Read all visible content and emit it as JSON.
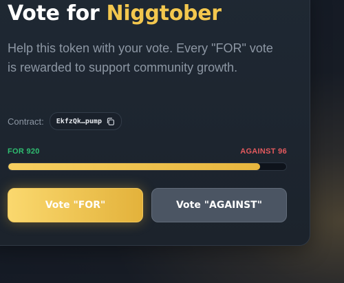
{
  "header": {
    "title_prefix": "Vote for ",
    "title_token": "Niggtober"
  },
  "description": "Help this token with your vote. Every \"FOR\" vote is rewarded to support community growth.",
  "contract": {
    "label": "Contract:",
    "value": "EkfzQk…pump",
    "copy_icon": "copy-icon"
  },
  "tally": {
    "for_label": "FOR 920",
    "against_label": "AGAINST 96",
    "for_votes": 920,
    "against_votes": 96,
    "for_fraction": 0.9055
  },
  "buttons": {
    "vote_for_label": "Vote \"FOR\"",
    "vote_against_label": "Vote \"AGAINST\""
  },
  "colors": {
    "accent": "#f3c74e",
    "for": "#2fbf71",
    "against": "#e55a5e",
    "progress_fill": "#f0c451",
    "against_button": "#4b5563"
  }
}
